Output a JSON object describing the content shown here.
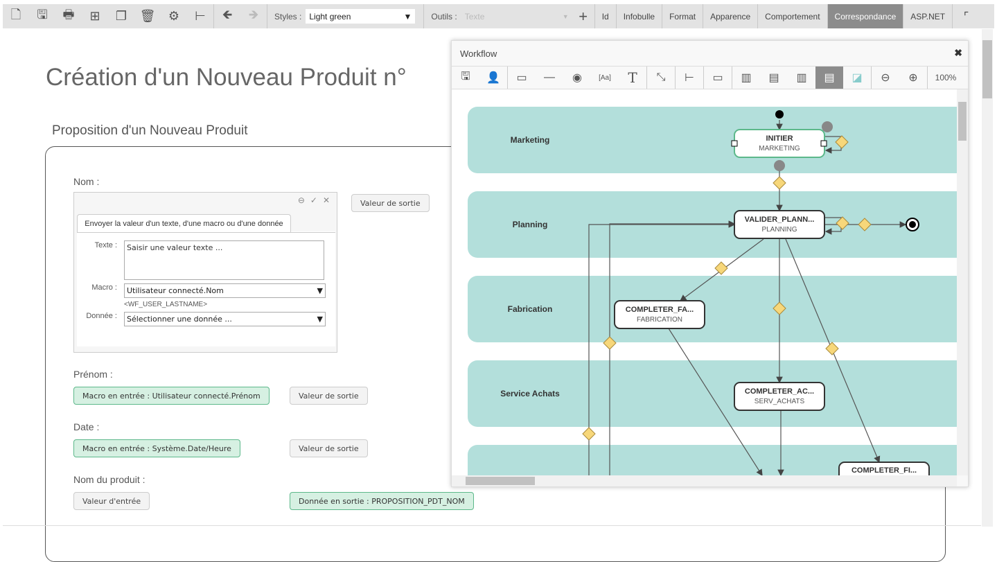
{
  "toolbar": {
    "icons": [
      "new-document-icon",
      "save-icon",
      "print-icon",
      "add-grid-icon",
      "window-icon",
      "trash-icon",
      "gear-icon",
      "tree-icon",
      "undo-icon",
      "redo-icon"
    ],
    "styles_label": "Styles :",
    "styles_value": "Light green",
    "outils_label": "Outils :",
    "outils_value": "Texte",
    "tabs": [
      "Id",
      "Infobulle",
      "Format",
      "Apparence",
      "Comportement",
      "Correspondance",
      "ASP.NET"
    ],
    "active_tab": "Correspondance"
  },
  "page": {
    "title": "Création d'un Nouveau Produit n°",
    "subtitle": "Proposition d'un Nouveau Produit"
  },
  "form": {
    "nom_label": "Nom :",
    "popup": {
      "tab": "Envoyer la valeur d'un texte, d'une macro ou d'une donnée",
      "texte_label": "Texte :",
      "texte_placeholder": "Saisir une valeur texte ...",
      "macro_label": "Macro :",
      "macro_value": "Utilisateur connecté.Nom",
      "macro_code": "<WF_USER_LASTNAME>",
      "donnee_label": "Donnée :",
      "donnee_value": "Sélectionner une donnée ..."
    },
    "nom_output": "Valeur de sortie",
    "prenom_label": "Prénom :",
    "prenom_input": "Macro en entrée : Utilisateur connecté.Prénom",
    "prenom_output": "Valeur de sortie",
    "date_label": "Date :",
    "date_input": "Macro en entrée : Système.Date/Heure",
    "date_output": "Valeur de sortie",
    "produit_label": "Nom du produit :",
    "produit_input": "Valeur d'entrée",
    "produit_output": "Donnée en sortie : PROPOSITION_PDT_NOM"
  },
  "workflow": {
    "title": "Workflow",
    "zoom": "100%",
    "lanes": [
      "Marketing",
      "Planning",
      "Fabrication",
      "Service Achats",
      ""
    ],
    "nodes": [
      {
        "name": "INITIER",
        "lane": "MARKETING",
        "selected": true
      },
      {
        "name": "VALIDER_PLANN...",
        "lane": "PLANNING"
      },
      {
        "name": "COMPLETER_FA...",
        "lane": "FABRICATION"
      },
      {
        "name": "COMPLETER_AC...",
        "lane": "SERV_ACHATS"
      },
      {
        "name": "COMPLETER_FI...",
        "lane": ""
      }
    ],
    "colors": {
      "lane": "#b3dfdb",
      "gateway": "#f7d77a",
      "selected": "#5cb88a"
    }
  }
}
